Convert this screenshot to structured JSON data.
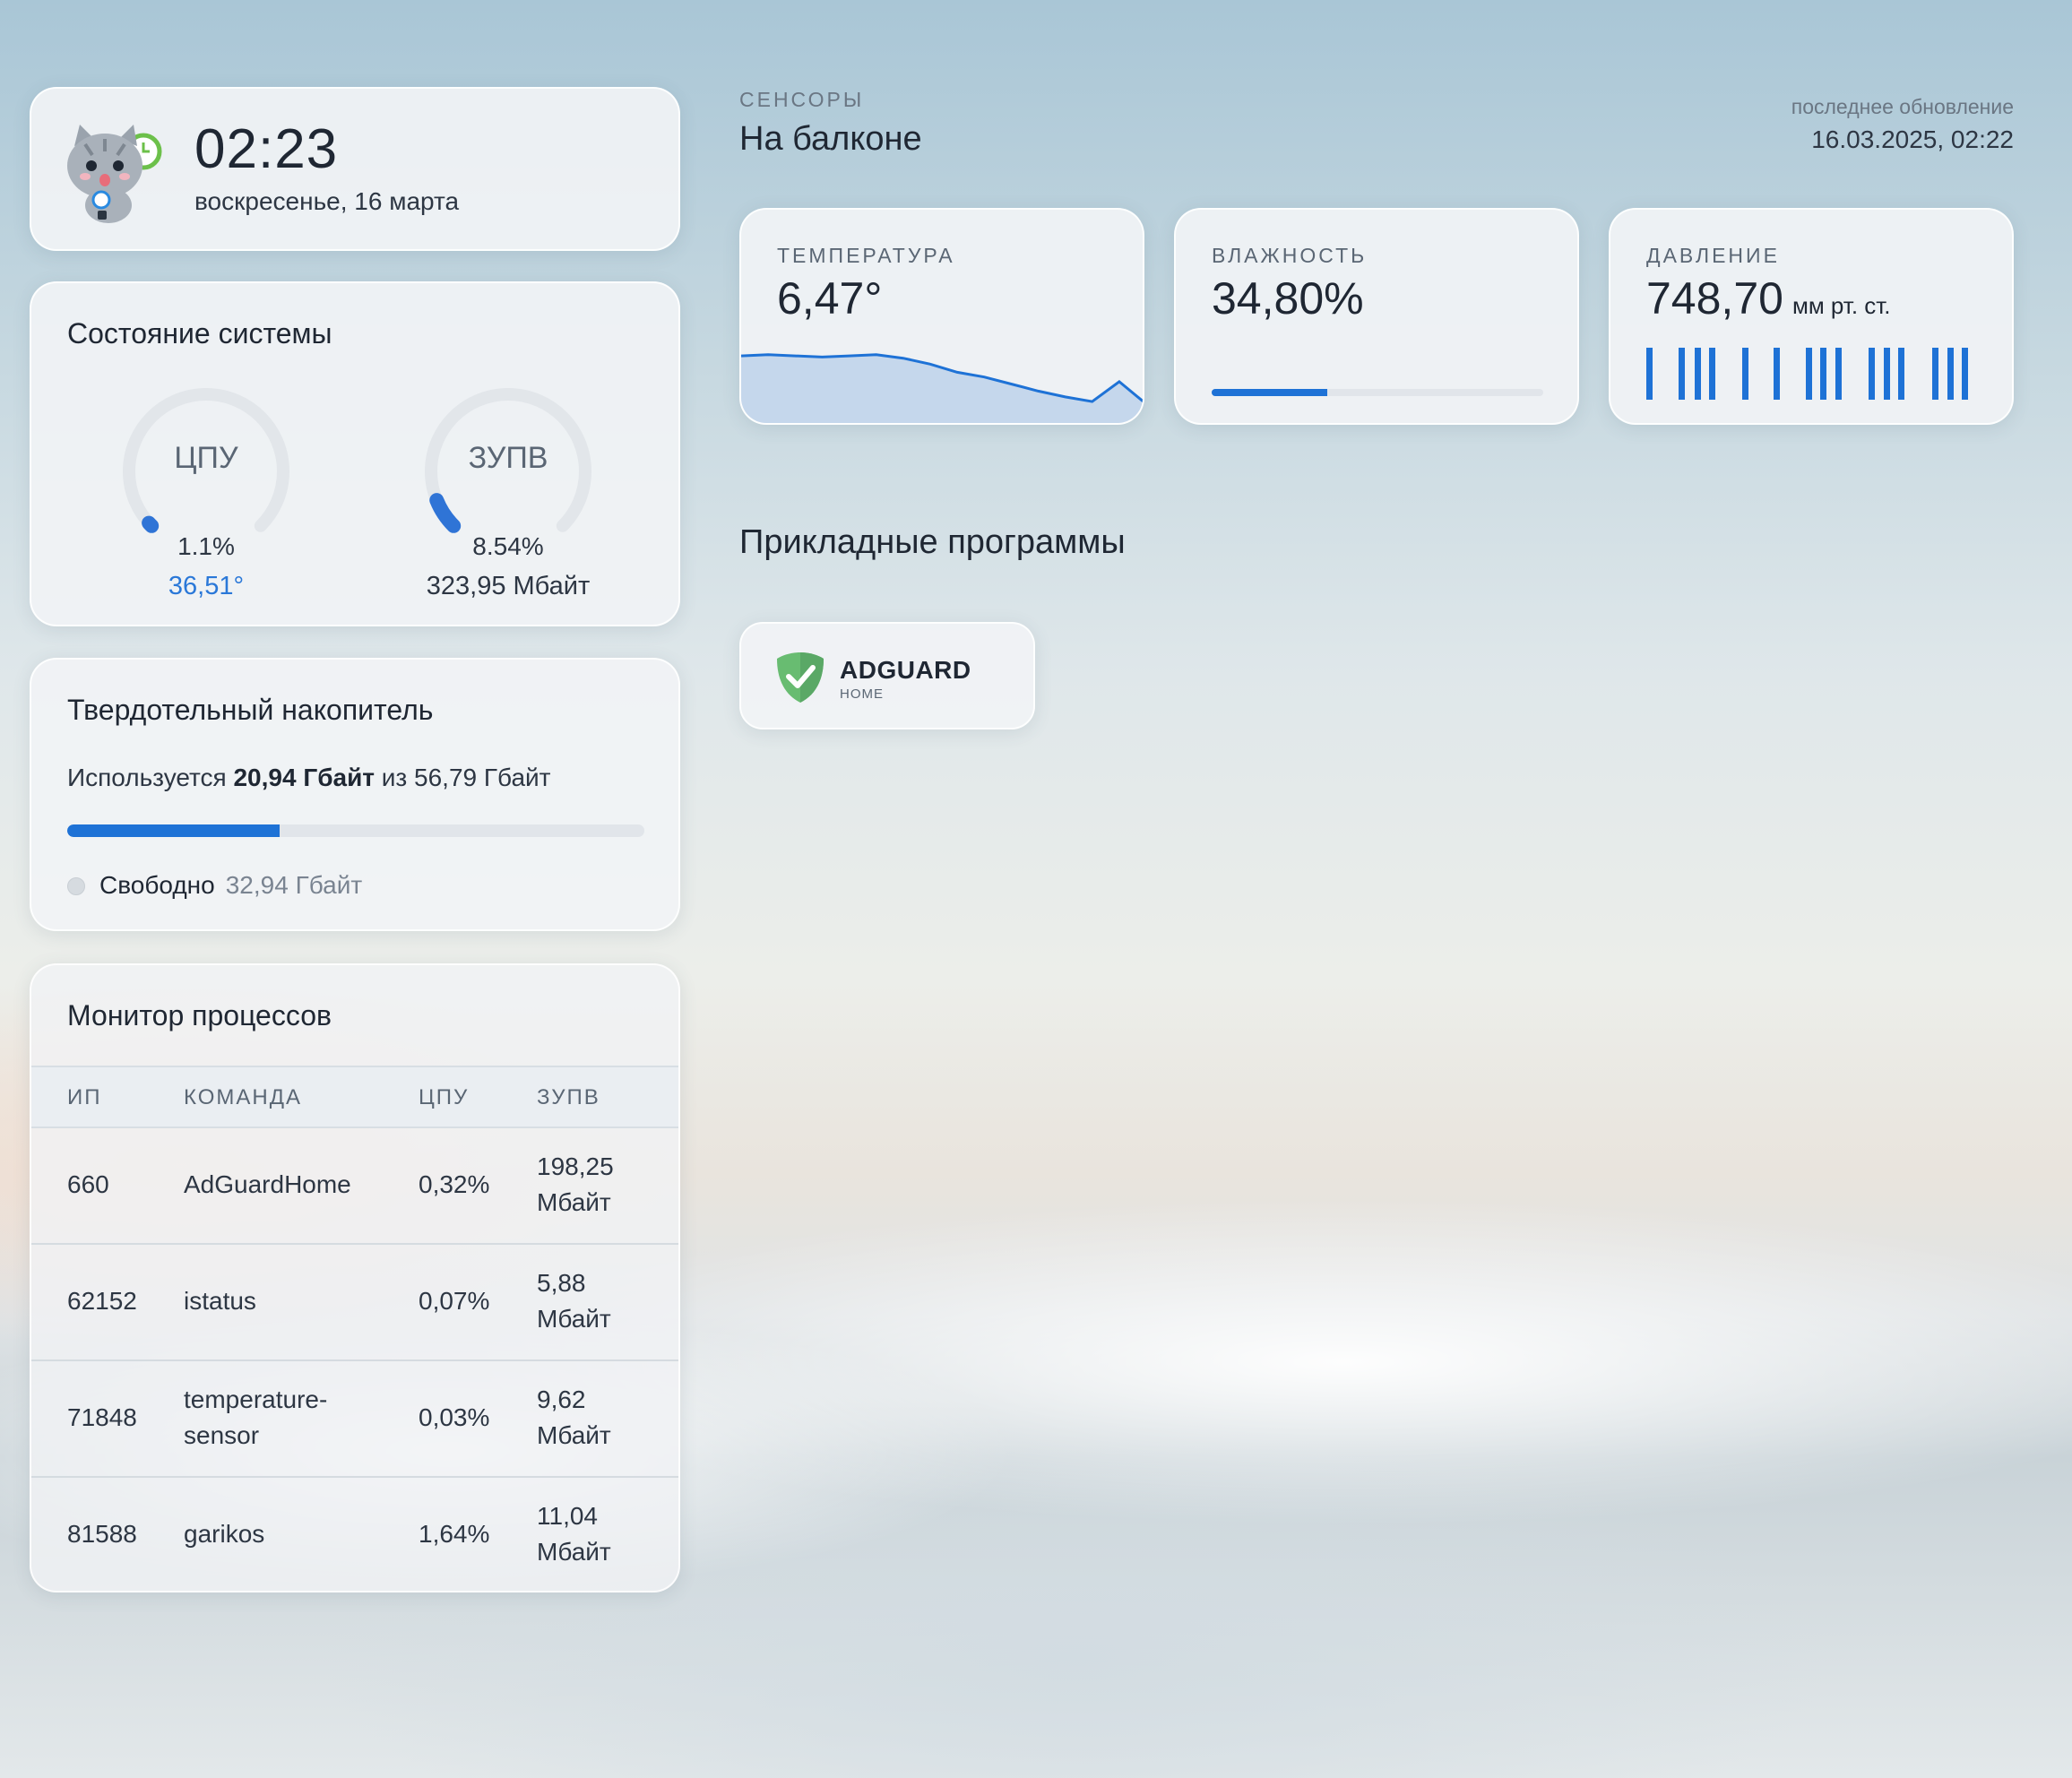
{
  "clock": {
    "time": "02:23",
    "date": "воскресенье, 16 марта",
    "avatar_icon": "cat-clock-icon"
  },
  "system": {
    "title": "Состояние системы",
    "cpu": {
      "label": "ЦПУ",
      "percent_text": "1.1%",
      "percent": 1.1,
      "temperature": "36,51°"
    },
    "ram": {
      "label": "ЗУПВ",
      "percent_text": "8.54%",
      "percent": 8.54,
      "used": "323,95 Мбайт"
    }
  },
  "ssd": {
    "title": "Твердотельный накопитель",
    "used_prefix": "Используется",
    "used": "20,94 Гбайт",
    "of_text": "из 56,79 Гбайт",
    "used_fraction": 0.3687,
    "free_label": "Свободно",
    "free_value": "32,94 Гбайт"
  },
  "processes": {
    "title": "Монитор процессов",
    "columns": [
      "ИП",
      "КОМАНДА",
      "ЦПУ",
      "ЗУПВ"
    ],
    "rows": [
      {
        "pid": "660",
        "command": "AdGuardHome",
        "cpu": "0,32%",
        "ram": "198,25 Мбайт"
      },
      {
        "pid": "62152",
        "command": "istatus",
        "cpu": "0,07%",
        "ram": "5,88 Мбайт"
      },
      {
        "pid": "71848",
        "command": "temperature-sensor",
        "cpu": "0,03%",
        "ram": "9,62 Мбайт"
      },
      {
        "pid": "81588",
        "command": "garikos",
        "cpu": "1,64%",
        "ram": "11,04 Мбайт"
      }
    ]
  },
  "sensors": {
    "kicker": "СЕНСОРЫ",
    "location": "На балконе",
    "updated_label": "последнее обновление",
    "updated_value": "16.03.2025, 02:22",
    "temperature": {
      "label": "ТЕМПЕРАТУРА",
      "value": "6,47°",
      "history": [
        9.0,
        9.1,
        9.0,
        8.9,
        9.0,
        9.1,
        8.8,
        8.3,
        7.6,
        7.2,
        6.6,
        6.0,
        5.5,
        5.1,
        6.8,
        4.9
      ]
    },
    "humidity": {
      "label": "ВЛАЖНОСТЬ",
      "value": "34,80%",
      "fraction": 0.348
    },
    "pressure": {
      "label": "ДАВЛЕНИЕ",
      "value": "748,70",
      "unit": "мм рт. ст."
    }
  },
  "apps": {
    "title": "Прикладные программы",
    "items": [
      {
        "name": "ADGUARD",
        "subtitle": "HOME",
        "icon": "adguard-shield-icon"
      }
    ]
  },
  "colors": {
    "accent": "#1e72d6",
    "gauge_track": "#e2e6ea",
    "adguard_green": "#68bc71"
  }
}
